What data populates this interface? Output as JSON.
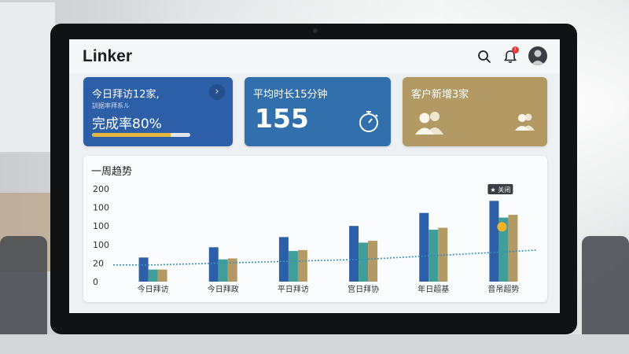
{
  "app": {
    "logo": "Linker",
    "notification_count": "1"
  },
  "cards": [
    {
      "title": "今日拜访12家,",
      "subtitle": "訓据率拜系ル",
      "rate_label": "完成率80%",
      "progress": 0.8,
      "color": "#2d5fa8"
    },
    {
      "title": "平均时长15分钟",
      "value": "155",
      "icon": "stopwatch-icon",
      "color": "#3170ac"
    },
    {
      "title": "客户新增3家",
      "icon": "people-icon",
      "color": "#b39a64"
    }
  ],
  "trend": {
    "title": "一周趋势"
  },
  "chart_data": {
    "type": "bar",
    "categories": [
      "今日拜访",
      "今日拜政",
      "平日拜访",
      "宫日拜协",
      "年日超基",
      "音吊超势"
    ],
    "yticks": [
      "200",
      "100",
      "100",
      "100",
      "20",
      "0"
    ],
    "series": [
      {
        "color": "#2d5fa8",
        "values": [
          26,
          37,
          48,
          60,
          74,
          87
        ]
      },
      {
        "color": "#3f9e9a",
        "values": [
          13,
          24,
          33,
          42,
          56,
          69
        ]
      },
      {
        "color": "#b39a64",
        "values": [
          13,
          25,
          34,
          44,
          58,
          72
        ]
      }
    ],
    "trend_line": [
      18,
      20,
      22,
      24,
      28,
      32
    ],
    "tooltip": "★ 关闭",
    "ylim": [
      0,
      100
    ]
  }
}
